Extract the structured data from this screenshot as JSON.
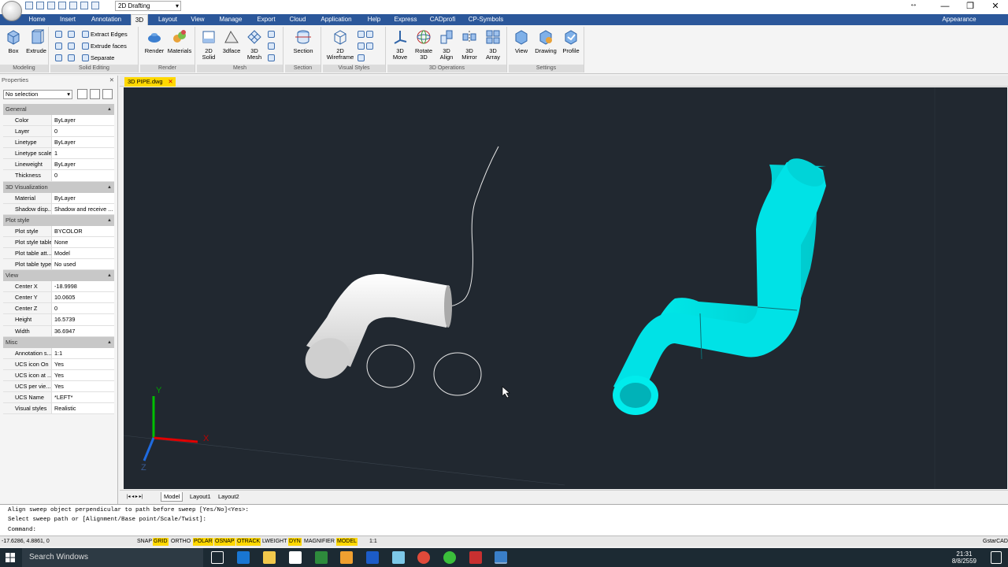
{
  "titlebar": {
    "workspace": "2D Drafting",
    "appearance": "Appearance"
  },
  "tabs": [
    "Home",
    "Insert",
    "Annotation",
    "3D",
    "Layout",
    "View",
    "Manage",
    "Export",
    "Cloud",
    "Application",
    "Help",
    "Express",
    "CADprofi",
    "CP-Symbols"
  ],
  "ribbon": {
    "modeling": {
      "title": "Modeling",
      "box": "Box",
      "extrude": "Extrude"
    },
    "solid_editing": {
      "title": "Solid Editing",
      "extract_edges": "Extract Edges",
      "extrude_faces": "Extrude faces",
      "separate": "Separate"
    },
    "render": {
      "title": "Render",
      "render": "Render",
      "materials": "Materials"
    },
    "mesh": {
      "title": "Mesh",
      "solid2d_1": "2D",
      "solid2d_2": "Solid",
      "face3d": "3dface",
      "mesh3d_1": "3D",
      "mesh3d_2": "Mesh"
    },
    "section": {
      "title": "Section",
      "section": "Section"
    },
    "visual_styles": {
      "title": "Visual Styles",
      "wire_1": "2D",
      "wire_2": "Wireframe"
    },
    "ops3d": {
      "title": "3D Operations",
      "move_1": "3D",
      "move_2": "Move",
      "rotate_1": "Rotate",
      "rotate_2": "3D",
      "align_1": "3D",
      "align_2": "Align",
      "mirror_1": "3D",
      "mirror_2": "Mirror",
      "array_1": "3D",
      "array_2": "Array"
    },
    "settings": {
      "title": "Settings",
      "view": "View",
      "drawing": "Drawing",
      "profile": "Profile"
    }
  },
  "properties": {
    "title": "Properties",
    "selection": "No selection",
    "general": {
      "title": "General",
      "rows": [
        [
          "Color",
          "ByLayer"
        ],
        [
          "Layer",
          "0"
        ],
        [
          "Linetype",
          "ByLayer"
        ],
        [
          "Linetype scale",
          "1"
        ],
        [
          "Lineweight",
          "ByLayer"
        ],
        [
          "Thickness",
          "0"
        ]
      ]
    },
    "vis3d": {
      "title": "3D Visualization",
      "rows": [
        [
          "Material",
          "ByLayer"
        ],
        [
          "Shadow disp...",
          "Shadow and receive ..."
        ]
      ]
    },
    "plot": {
      "title": "Plot style",
      "rows": [
        [
          "Plot style",
          "BYCOLOR"
        ],
        [
          "Plot style table",
          "None"
        ],
        [
          "Plot table att...",
          "Model"
        ],
        [
          "Plot table type",
          "No used"
        ]
      ]
    },
    "view": {
      "title": "View",
      "rows": [
        [
          "Center X",
          "-18.9998"
        ],
        [
          "Center Y",
          "10.0605"
        ],
        [
          "Center Z",
          "0"
        ],
        [
          "Height",
          "16.5739"
        ],
        [
          "Width",
          "36.6947"
        ]
      ]
    },
    "misc": {
      "title": "Misc",
      "rows": [
        [
          "Annotation s...",
          "1:1"
        ],
        [
          "UCS icon On",
          "Yes"
        ],
        [
          "UCS icon at ...",
          "Yes"
        ],
        [
          "UCS per vie...",
          "Yes"
        ],
        [
          "UCS Name",
          "*LEFT*"
        ],
        [
          "Visual styles",
          "Realistic"
        ]
      ]
    }
  },
  "document": {
    "tab": "3D PIPE.dwg"
  },
  "axes": {
    "x": "X",
    "y": "Y",
    "z": "Z"
  },
  "layout_tabs": [
    "Model",
    "Layout1",
    "Layout2"
  ],
  "command": {
    "line1": "Align sweep object perpendicular to path before sweep [Yes/No]<Yes>:",
    "line2": "Select sweep path or [Alignment/Base point/Scale/Twist]:",
    "prompt": "Command:"
  },
  "status": {
    "coords": "-17.6286, 4.8861, 0",
    "buttons": [
      "SNAP",
      "GRID",
      "ORTHO",
      "POLAR",
      "OSNAP",
      "OTRACK",
      "LWEIGHT",
      "DYN",
      "MAGNIFIER",
      "MODEL"
    ],
    "scale": "1:1",
    "brand": "GstarCAD"
  },
  "taskbar": {
    "search": "Search Windows",
    "time": "21:31",
    "date": "8/8/2559"
  }
}
